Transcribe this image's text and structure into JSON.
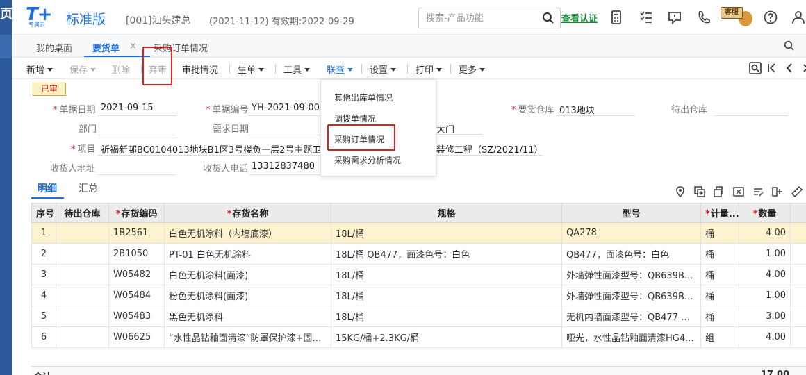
{
  "left_strip": {
    "glyph": "页"
  },
  "header": {
    "logo_text": "T+",
    "logo_sub": "专属云",
    "brand": "标准版",
    "company": "[001]汕头建总",
    "period": "(2021-11-12)  有效期:2022-09-29",
    "search_placeholder": "搜索-产品功能",
    "verify_link": "查看认证",
    "service_badge": "客服",
    "icons": [
      "calculator-icon",
      "checklist-icon",
      "message-icon",
      "phone-icon",
      "help-icon",
      "user-icon"
    ]
  },
  "tabs": {
    "items": [
      "我的桌面",
      "要货单",
      "采购订单情况"
    ],
    "active": "要货单",
    "close_glyph": "×"
  },
  "toolbar": {
    "new": "新增",
    "save": "保存",
    "delete": "删除",
    "abandon_audit": "弃审",
    "approval": "审批情况",
    "generate": "生单",
    "tools": "工具",
    "link_query": "联查",
    "settings": "设置",
    "print": "打印",
    "more": "更多"
  },
  "status_badge": "已审",
  "form": {
    "doc_date_label": "单据日期",
    "doc_date": "2021-09-15",
    "doc_no_label": "单据编号",
    "doc_no": "YH-2021-09-0035",
    "warehouse_label": "要货仓库",
    "warehouse": "013地块",
    "out_warehouse_label": "待出仓库",
    "dept_label": "部门",
    "need_date_label": "需求日期",
    "partial_right_1": "大门",
    "project_label": "项目",
    "project": "祈福新邨BC0104013地块B1区3号楼负一层2号主题卫生",
    "project_tail": "装修工程（SZ/2021/11）",
    "recv_addr_label": "收货人地址",
    "recv_phone_label": "收货人电话",
    "recv_phone": "13312837480"
  },
  "menu": {
    "items": [
      "其他出库单情况",
      "调拨单情况",
      "采购订单情况",
      "采购需求分析情况"
    ]
  },
  "detail_tabs": {
    "items": [
      "明细",
      "汇总"
    ],
    "active": "明细"
  },
  "table": {
    "headers": [
      "序号",
      "待出仓库",
      "存货编码",
      "存货名称",
      "规格",
      "型号",
      "计量...",
      "数量"
    ],
    "rows": [
      [
        "1",
        "",
        "1B2561",
        "白色无机涂料（内墙底漆）",
        "18L/桶",
        "QA278",
        "桶",
        "4.00"
      ],
      [
        "2",
        "",
        "2B1050",
        "PT-01 白色无机涂料",
        "18L/桶 QB477，面漆色号：白色",
        "QB477，面漆色号：白色",
        "桶",
        "1.00"
      ],
      [
        "3",
        "",
        "W05482",
        "白色无机涂料(面漆)",
        "18L/桶",
        "外墙弹性面漆型号：QB639B...",
        "桶",
        "4.00"
      ],
      [
        "4",
        "",
        "W05484",
        "粉色无机涂料(面漆)",
        "18L/桶",
        "外墙弹性面漆型号：QB639B...",
        "桶",
        "1.00"
      ],
      [
        "5",
        "",
        "W05483",
        "黑色无机涂料",
        "18L/桶",
        "无机内墙面漆型号：QB477 色...",
        "桶",
        "3.00"
      ],
      [
        "6",
        "",
        "W06625",
        "“水性晶钻釉面清漆”防罩保护漆+固化剂",
        "15KG/桶+2.3KG/桶",
        "哑光，水性晶钻釉面清漆HG4...",
        "组",
        "4.00"
      ]
    ]
  },
  "total": {
    "label": "合计",
    "value": "17.00"
  }
}
